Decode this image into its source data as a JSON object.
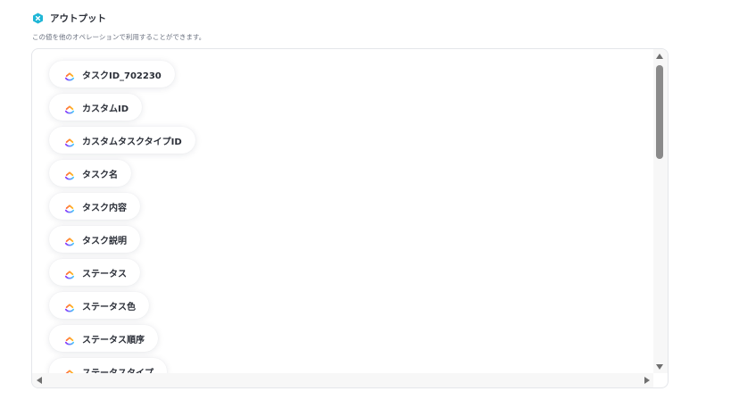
{
  "section": {
    "title": "アウトプット",
    "subtitle": "この値を他のオペレーションで利用することができます。",
    "icon": "teal-hexagon-x-icon",
    "icon_color": "#1fb6d6"
  },
  "output_items": [
    {
      "label": "タスクID_702230"
    },
    {
      "label": "カスタムID"
    },
    {
      "label": "カスタムタスクタイプID"
    },
    {
      "label": "タスク名"
    },
    {
      "label": "タスク内容"
    },
    {
      "label": "タスク説明"
    },
    {
      "label": "ステータス"
    },
    {
      "label": "ステータス色"
    },
    {
      "label": "ステータス順序"
    },
    {
      "label": "ステータスタイプ"
    }
  ],
  "item_icon": "clickup-logo-icon"
}
